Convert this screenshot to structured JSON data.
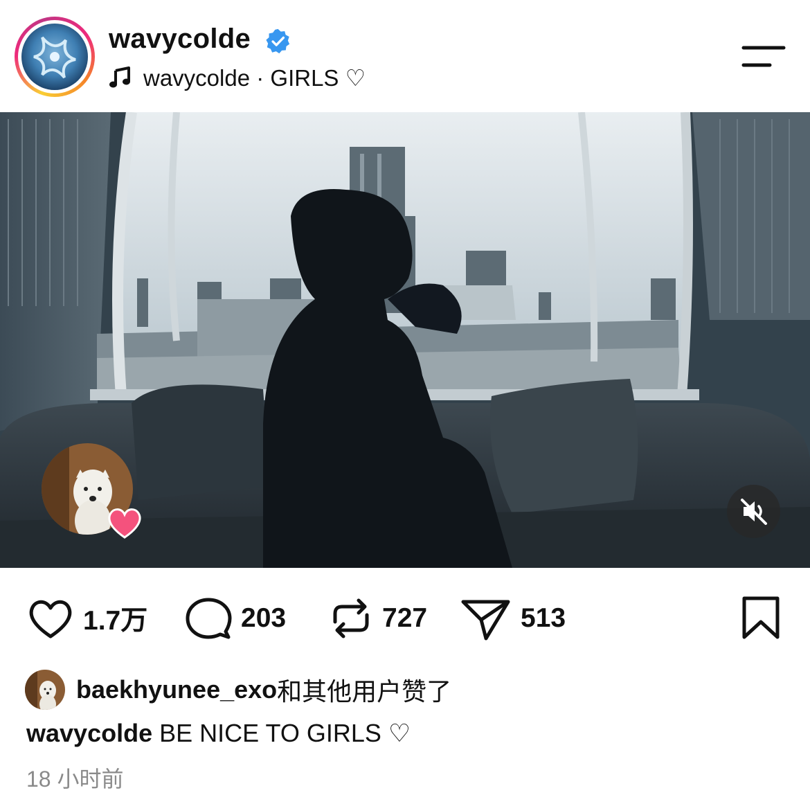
{
  "header": {
    "username": "wavycolde",
    "music_label": "wavycolde · GIRLS ♡"
  },
  "media": {
    "mute_icon": "speaker-muted-icon",
    "liker_bubble_heart": "heart-icon"
  },
  "actions": {
    "likes": "1.7万",
    "comments": "203",
    "reposts": "727",
    "shares": "513"
  },
  "liked_by": {
    "name": "baekhyunee_exo",
    "suffix": "和其他用户赞了"
  },
  "caption": {
    "author": "wavycolde",
    "text": " BE NICE TO GIRLS ♡"
  },
  "timestamp": "18 小时前",
  "colors": {
    "verified": "#3897f0",
    "heart": "#f4527d",
    "text": "#111111",
    "muted_text": "#8a8a8a"
  }
}
